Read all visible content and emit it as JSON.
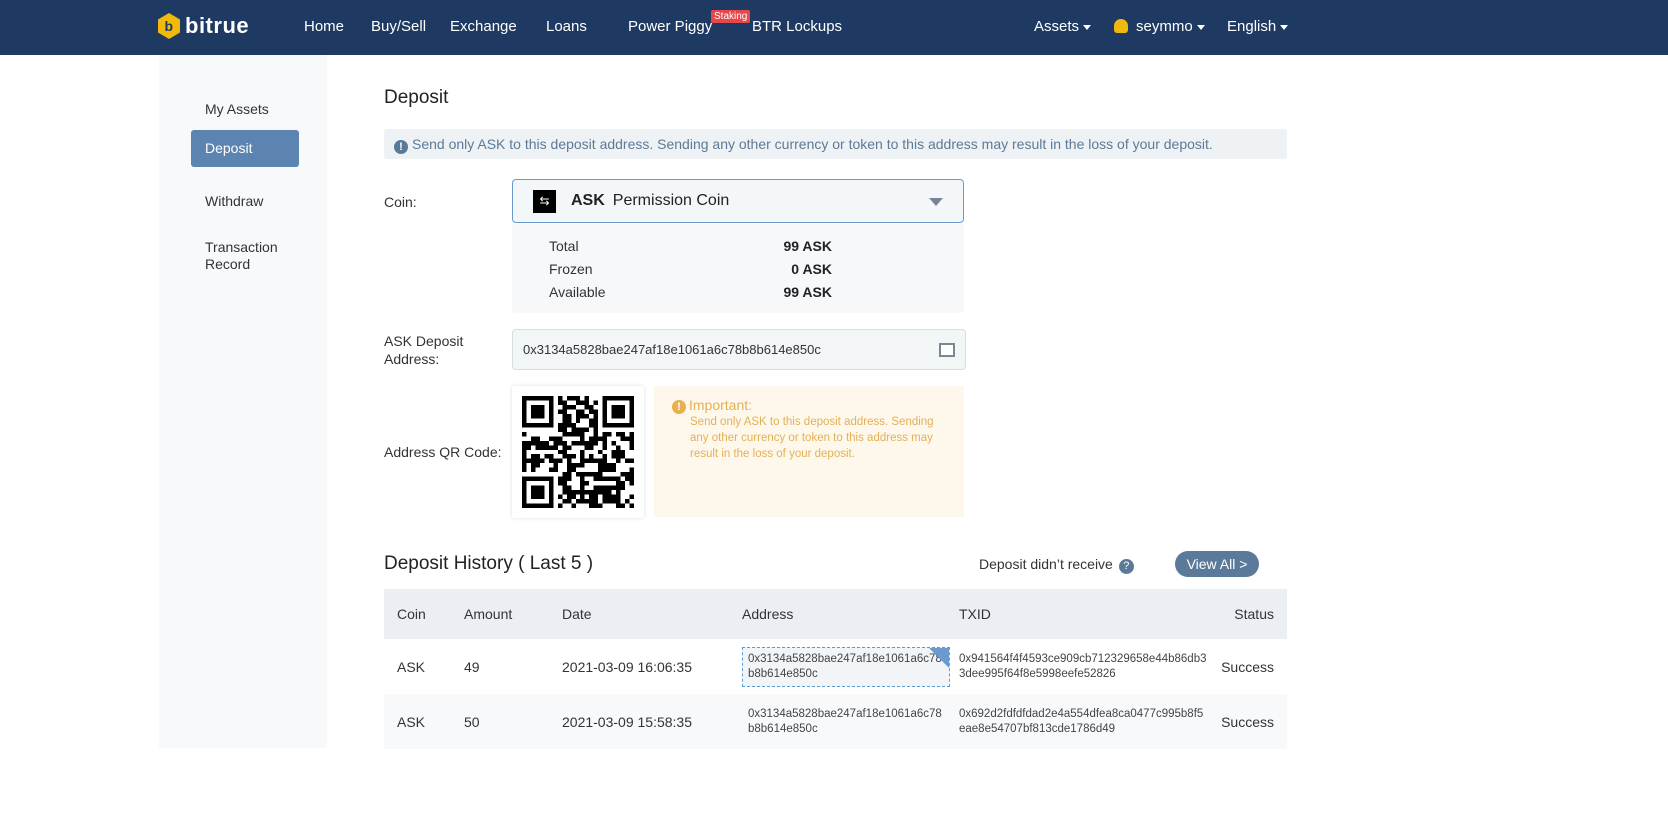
{
  "nav": {
    "logo": "bitrue",
    "items": [
      "Home",
      "Buy/Sell",
      "Exchange",
      "Loans",
      "Power Piggy",
      "BTR Lockups"
    ],
    "badge": "Staking",
    "assets": "Assets",
    "user": "seymmo",
    "language": "English"
  },
  "sidebar": {
    "items": [
      "My Assets",
      "Deposit",
      "Withdraw",
      "Transaction Record"
    ]
  },
  "page_title": "Deposit",
  "warning": "Send only ASK to this deposit address. Sending any other currency or token to this address may result in the loss of your deposit.",
  "coin": {
    "label": "Coin:",
    "symbol": "ASK",
    "name": "Permission Coin"
  },
  "balance": [
    {
      "label": "Total",
      "value": "99 ASK"
    },
    {
      "label": "Frozen",
      "value": "0 ASK"
    },
    {
      "label": "Available",
      "value": "99 ASK"
    }
  ],
  "address": {
    "label": "ASK Deposit Address:",
    "value": "0x3134a5828bae247af18e1061a6c78b8b614e850c"
  },
  "qr": {
    "label": "Address QR Code:"
  },
  "important": {
    "title": "Important:",
    "text": "Send only ASK to this deposit address. Sending any other currency or token to this address may result in the loss of your deposit."
  },
  "history": {
    "title": "Deposit History ( Last 5 )",
    "not_received": "Deposit didn’t receive",
    "view_all": "View All >",
    "columns": [
      "Coin",
      "Amount",
      "Date",
      "Address",
      "TXID",
      "Status"
    ],
    "rows": [
      {
        "coin": "ASK",
        "amount": "49",
        "date": "2021-03-09 16:06:35",
        "address": "0x3134a5828bae247af18e1061a6c78b8b614e850c",
        "txid": "0x941564f4f4593ce909cb712329658e44b86db33dee995f64f8e5998eefe52826",
        "status": "Success"
      },
      {
        "coin": "ASK",
        "amount": "50",
        "date": "2021-03-09 15:58:35",
        "address": "0x3134a5828bae247af18e1061a6c78b8b614e850c",
        "txid": "0x692d2fdfdfdad2e4a554dfea8ca0477c995b8f5eae8e54707bf813cde1786d49",
        "status": "Success"
      }
    ]
  }
}
